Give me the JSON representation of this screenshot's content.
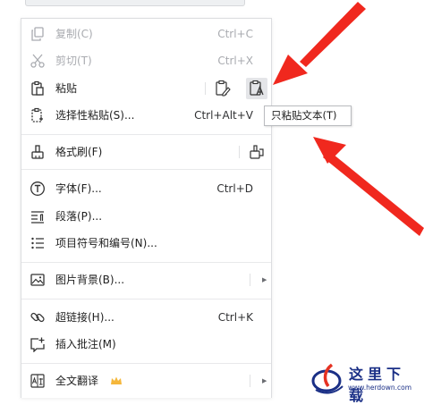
{
  "menu": {
    "copy": {
      "label": "复制(C)",
      "shortcut": "Ctrl+C",
      "icon": "copy-icon"
    },
    "cut": {
      "label": "剪切(T)",
      "shortcut": "Ctrl+X",
      "icon": "scissors-icon"
    },
    "paste": {
      "label": "粘贴",
      "icon": "paste-icon",
      "options": [
        "keep-format-paste-icon",
        "paste-text-only-icon"
      ]
    },
    "paste_special": {
      "label": "选择性粘贴(S)...",
      "shortcut": "Ctrl+Alt+V",
      "icon": "paste-special-icon"
    },
    "format_painter": {
      "label": "格式刷(F)",
      "icon": "format-painter-icon"
    },
    "font": {
      "label": "字体(F)...",
      "shortcut": "Ctrl+D",
      "icon": "font-icon"
    },
    "paragraph": {
      "label": "段落(P)...",
      "icon": "paragraph-icon"
    },
    "bullets": {
      "label": "项目符号和编号(N)...",
      "icon": "list-icon"
    },
    "background": {
      "label": "图片背景(B)...",
      "icon": "image-icon"
    },
    "hyperlink": {
      "label": "超链接(H)...",
      "shortcut": "Ctrl+K",
      "icon": "link-icon"
    },
    "comment": {
      "label": "插入批注(M)",
      "icon": "comment-icon"
    },
    "translate": {
      "label": "全文翻译",
      "icon": "translate-icon",
      "badge": "crown-icon"
    }
  },
  "tooltip": {
    "text": "只粘贴文本(T)"
  },
  "watermark": {
    "title": "这里下载",
    "url": "www.herdown.com"
  },
  "colors": {
    "arrow": "#f0281e",
    "disabled": "#a9abb0",
    "text": "#1f1f1f",
    "crown": "#f5b73b",
    "watermark": "#1a2f86"
  }
}
